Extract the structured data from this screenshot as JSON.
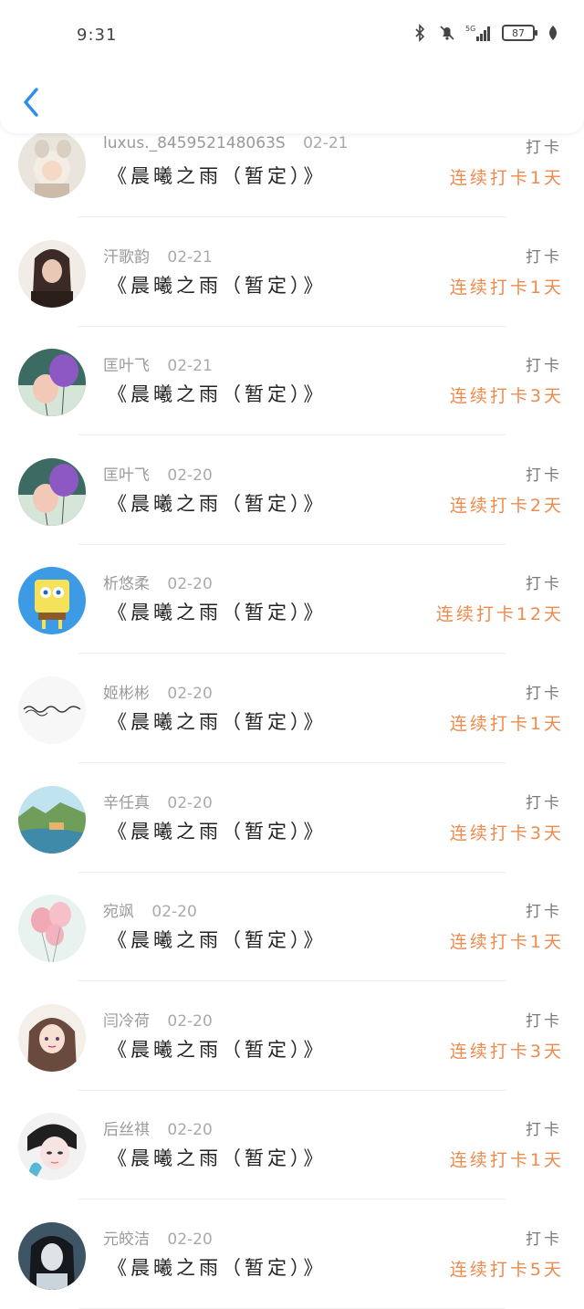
{
  "status_bar": {
    "time": "9:31",
    "network": "5G",
    "battery": "87"
  },
  "header": {
    "back_icon": "chevron-left-icon"
  },
  "entries": [
    {
      "name": "luxus._845952148063S",
      "date": "02-21",
      "book": "《晨曦之雨（暂定）》",
      "action": "打卡",
      "streak": "连续打卡1天",
      "avatar": "cat-girl"
    },
    {
      "name": "汗歌韵",
      "date": "02-21",
      "book": "《晨曦之雨（暂定）》",
      "action": "打卡",
      "streak": "连续打卡1天",
      "avatar": "woman-dark"
    },
    {
      "name": "匡叶飞",
      "date": "02-21",
      "book": "《晨曦之雨（暂定）》",
      "action": "打卡",
      "streak": "连续打卡3天",
      "avatar": "balloons"
    },
    {
      "name": "匡叶飞",
      "date": "02-20",
      "book": "《晨曦之雨（暂定）》",
      "action": "打卡",
      "streak": "连续打卡2天",
      "avatar": "balloons"
    },
    {
      "name": "析悠柔",
      "date": "02-20",
      "book": "《晨曦之雨（暂定）》",
      "action": "打卡",
      "streak": "连续打卡12天",
      "avatar": "sponge"
    },
    {
      "name": "姬彬彬",
      "date": "02-20",
      "book": "《晨曦之雨（暂定）》",
      "action": "打卡",
      "streak": "连续打卡1天",
      "avatar": "handwriting"
    },
    {
      "name": "辛任真",
      "date": "02-20",
      "book": "《晨曦之雨（暂定）》",
      "action": "打卡",
      "streak": "连续打卡3天",
      "avatar": "landscape"
    },
    {
      "name": "宛飒",
      "date": "02-20",
      "book": "《晨曦之雨（暂定）》",
      "action": "打卡",
      "streak": "连续打卡1天",
      "avatar": "pink-balloons"
    },
    {
      "name": "闫冷荷",
      "date": "02-20",
      "book": "《晨曦之雨（暂定）》",
      "action": "打卡",
      "streak": "连续打卡3天",
      "avatar": "anime-girl"
    },
    {
      "name": "后丝祺",
      "date": "02-20",
      "book": "《晨曦之雨（暂定）》",
      "action": "打卡",
      "streak": "连续打卡1天",
      "avatar": "pale-face"
    },
    {
      "name": "元皎洁",
      "date": "02-20",
      "book": "《晨曦之雨（暂定）》",
      "action": "打卡",
      "streak": "连续打卡5天",
      "avatar": "dark-hair"
    }
  ],
  "colors": {
    "streak": "#ee8a4c",
    "back": "#2b8ee6"
  }
}
